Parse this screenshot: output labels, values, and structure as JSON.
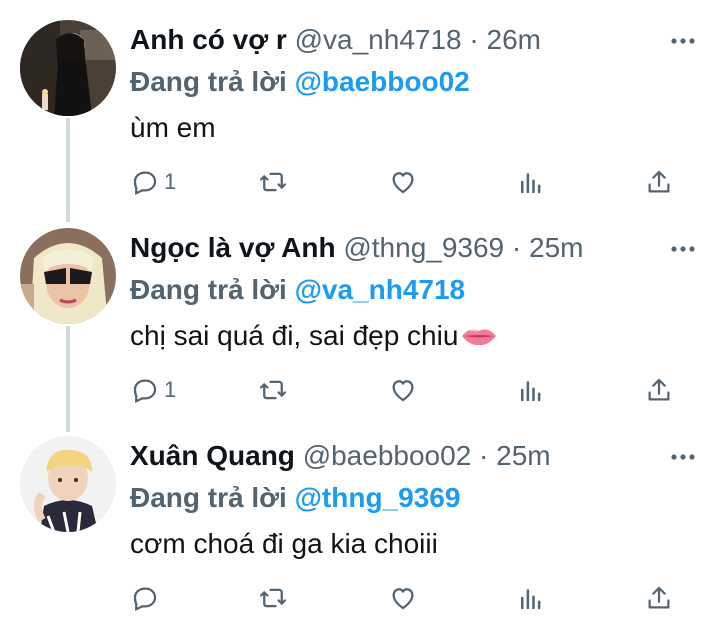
{
  "tweets": [
    {
      "name": "Anh có vợ r",
      "handle": "@va_nh4718",
      "separator": "·",
      "time": "26m",
      "reply_prefix": "Đang trả lời",
      "reply_to": "@baebboo02",
      "text": "ùm em",
      "reply_count": "1",
      "avatar": "avatar-dark-photo"
    },
    {
      "name": "Ngọc là vợ Anh",
      "handle": "@thng_9369",
      "separator": "·",
      "time": "25m",
      "reply_prefix": "Đang trả lời",
      "reply_to": "@va_nh4718",
      "text": "chị sai quá đi, sai đẹp chiu",
      "emoji": "lips-emoji",
      "reply_count": "1",
      "avatar": "avatar-blonde-sunglasses"
    },
    {
      "name": "Xuân Quang",
      "handle": "@baebboo02",
      "separator": "·",
      "time": "25m",
      "reply_prefix": "Đang trả lời",
      "reply_to": "@thng_9369",
      "text": "cơm choá đi ga kia choiii",
      "reply_count": "",
      "avatar": "avatar-blonde-boy"
    }
  ],
  "colors": {
    "link": "#1d9bf0",
    "secondary": "#536471",
    "thread_line": "#cfd9de"
  }
}
